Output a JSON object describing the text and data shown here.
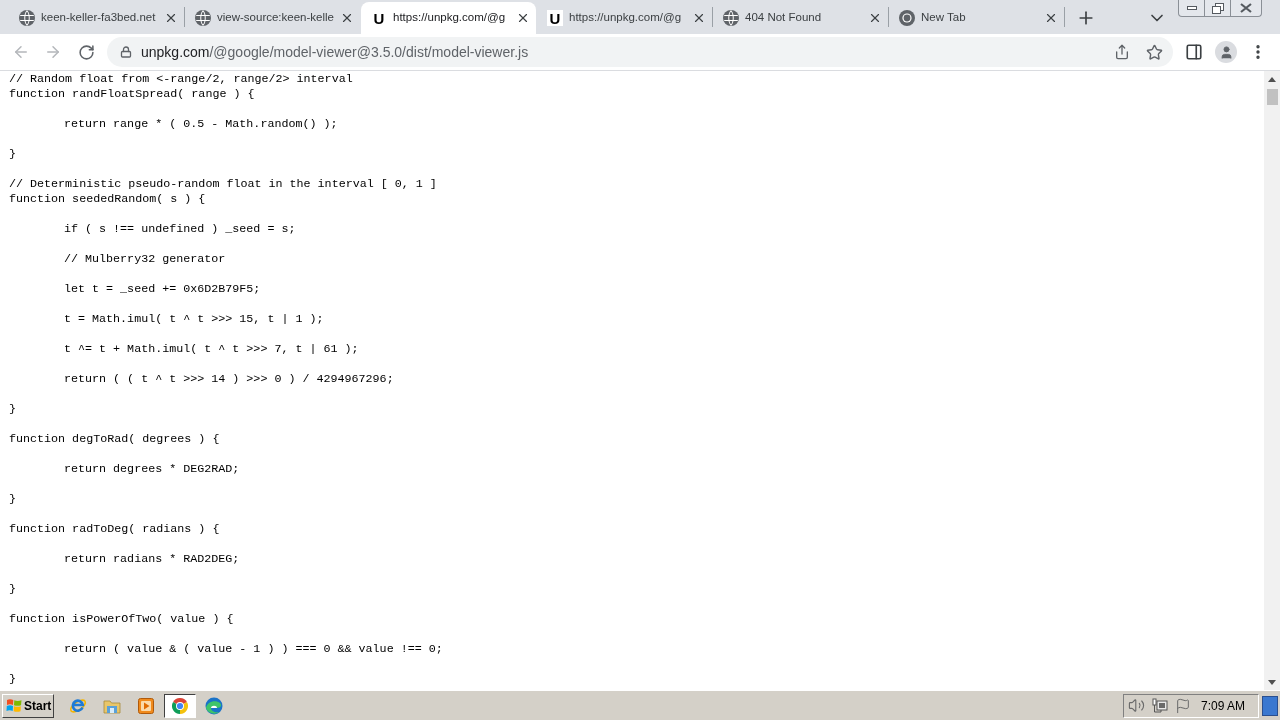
{
  "tabs": [
    {
      "title": "keen-keller-fa3bed.net",
      "favicon": {
        "kind": "globe"
      },
      "selected": false
    },
    {
      "title": "view-source:keen-kelle",
      "favicon": {
        "kind": "globe"
      },
      "selected": false
    },
    {
      "title": "https://unpkg.com/@g",
      "favicon": {
        "kind": "letter",
        "text": "U"
      },
      "selected": true
    },
    {
      "title": "https://unpkg.com/@g",
      "favicon": {
        "kind": "letter",
        "text": "U"
      },
      "selected": false
    },
    {
      "title": "404 Not Found",
      "favicon": {
        "kind": "globe"
      },
      "selected": false
    },
    {
      "title": "New Tab",
      "favicon": {
        "kind": "round-browser"
      },
      "selected": false
    }
  ],
  "toolbar": {
    "back": {
      "disabled": true
    },
    "forward": {
      "disabled": true
    },
    "address": {
      "host": "unpkg.com",
      "path": "/@google/model-viewer@3.5.0/dist/model-viewer.js"
    }
  },
  "code": {
    "functions": [
      {
        "comment": "// Random float from <-range/2, range/2> interval",
        "signature": "function randFloatSpread( range ) {",
        "body": [
          "return range * ( 0.5 - Math.random() );"
        ],
        "closing": "}"
      },
      {
        "comment": "// Deterministic pseudo-random float in the interval [ 0, 1 ]",
        "signature": "function seededRandom( s ) {",
        "body": [
          "if ( s !== undefined ) _seed = s;",
          "// Mulberry32 generator",
          "let t = _seed += 0x6D2B79F5;",
          "t = Math.imul( t ^ t >>> 15, t | 1 );",
          "t ^= t + Math.imul( t ^ t >>> 7, t | 61 );",
          "return ( ( t ^ t >>> 14 ) >>> 0 ) / 4294967296;"
        ],
        "closing": "}"
      },
      {
        "signature": "function degToRad( degrees ) {",
        "body": [
          "return degrees * DEG2RAD;"
        ],
        "closing": "}"
      },
      {
        "signature": "function radToDeg( radians ) {",
        "body": [
          "return radians * RAD2DEG;"
        ],
        "closing": "}"
      },
      {
        "signature": "function isPowerOfTwo( value ) {",
        "body": [
          "return ( value & ( value - 1 ) ) === 0 && value !== 0;"
        ],
        "closing": "}"
      }
    ]
  },
  "taskbar": {
    "start_label": "Start",
    "apps": [
      {
        "kind": "e-swoosh",
        "selected": false
      },
      {
        "kind": "folder",
        "selected": false
      },
      {
        "kind": "play",
        "selected": false
      },
      {
        "kind": "round-browser",
        "selected": true
      },
      {
        "kind": "swirl",
        "selected": false
      }
    ],
    "clock": "7:09 AM"
  }
}
